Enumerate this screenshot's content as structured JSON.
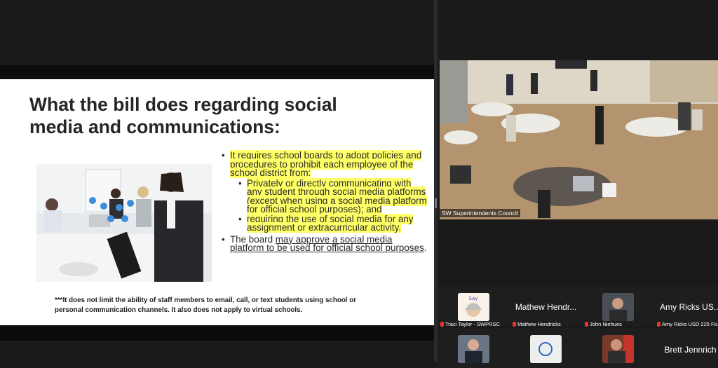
{
  "slide": {
    "title_line1": "What the bill does regarding social",
    "title_line2": "media and communications:",
    "bullet1": "It requires school boards to adopt policies and procedures to prohibit each employee of the school district from:",
    "sub1": "Privately or directly communicating with any student through social media platforms (except when using a social media platform for official school purposes); and",
    "sub2": "requiring the use of social media for any assignment or extracurricular activity.",
    "bullet2_prefix": "The board ",
    "bullet2_link": "may approve a social media platform to be used for official school purposes",
    "bullet2_suffix": ".",
    "footnote_line1": "***It does not limit the ability of staff members to email, call, or text students using school or",
    "footnote_line2": "personal communication channels.  It also does not apply to virtual schools."
  },
  "video": {
    "label": "SW Superintendents Council"
  },
  "participants": [
    {
      "caption": "Traci Taylor - SWPRSC",
      "big_name": "",
      "avatar": "sticker-avatar"
    },
    {
      "caption": "Mathew Hendricks",
      "big_name": "Mathew Hendr...",
      "avatar": ""
    },
    {
      "caption": "John Niehues",
      "big_name": "",
      "avatar": "photo-avatar"
    },
    {
      "caption": "Amy Ricks USD 225 Fo...",
      "big_name": "Amy Ricks US...",
      "avatar": ""
    },
    {
      "caption": "",
      "big_name": "",
      "avatar": "photo-avatar"
    },
    {
      "caption": "",
      "big_name": "",
      "avatar": "logo-avatar"
    },
    {
      "caption": "",
      "big_name": "",
      "avatar": "photo-avatar"
    },
    {
      "caption": "",
      "big_name": "Brett Jennrich",
      "avatar": ""
    }
  ],
  "colors": {
    "highlight": "#ffff66",
    "muted_mic": "#e33333",
    "background": "#1a1a1a"
  }
}
